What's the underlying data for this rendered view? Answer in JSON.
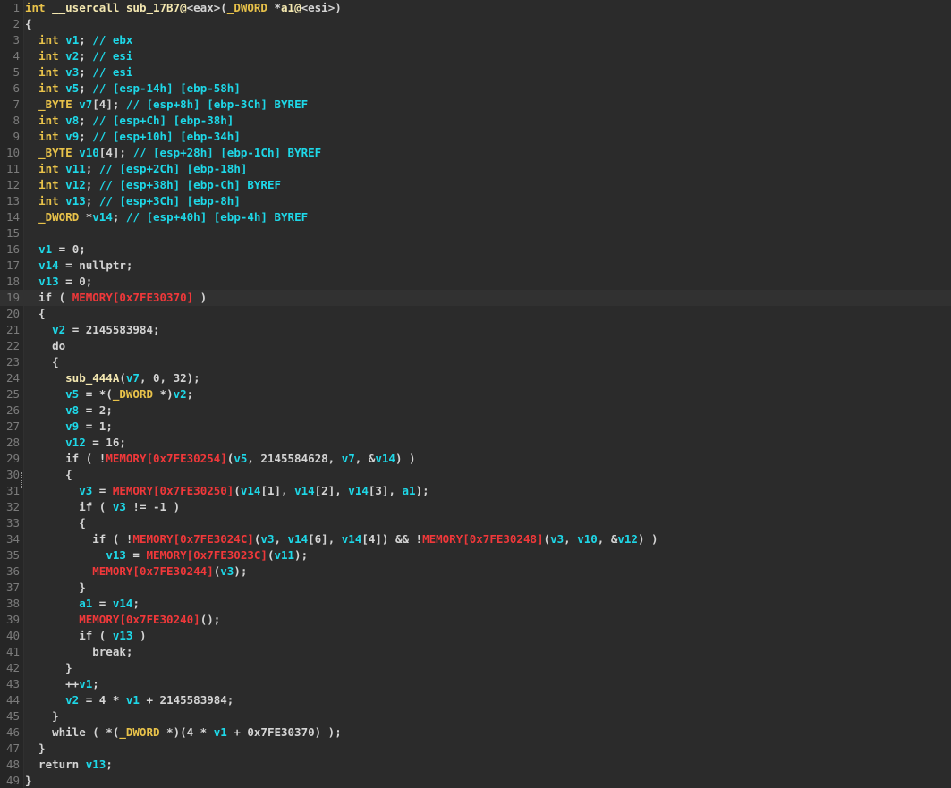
{
  "editor": {
    "highlighted_line": 19,
    "lines": [
      {
        "n": "1",
        "tokens": [
          [
            "kw",
            "int "
          ],
          [
            "fn",
            "__usercall sub_17B7@"
          ],
          [
            "pl",
            "<eax>"
          ],
          [
            "pl",
            "("
          ],
          [
            "tp",
            "_DWORD "
          ],
          [
            "pl",
            "*"
          ],
          [
            "fn",
            "a1@"
          ],
          [
            "pl",
            "<esi>"
          ],
          [
            "pl",
            ")"
          ]
        ]
      },
      {
        "n": "2",
        "tokens": [
          [
            "pl",
            "{"
          ]
        ]
      },
      {
        "n": "3",
        "tokens": [
          [
            "pl",
            "  "
          ],
          [
            "kw",
            "int "
          ],
          [
            "var",
            "v1"
          ],
          [
            "pl",
            "; "
          ],
          [
            "cm",
            "// ebx"
          ]
        ]
      },
      {
        "n": "4",
        "tokens": [
          [
            "pl",
            "  "
          ],
          [
            "kw",
            "int "
          ],
          [
            "var",
            "v2"
          ],
          [
            "pl",
            "; "
          ],
          [
            "cm",
            "// esi"
          ]
        ]
      },
      {
        "n": "5",
        "tokens": [
          [
            "pl",
            "  "
          ],
          [
            "kw",
            "int "
          ],
          [
            "var",
            "v3"
          ],
          [
            "pl",
            "; "
          ],
          [
            "cm",
            "// esi"
          ]
        ]
      },
      {
        "n": "6",
        "tokens": [
          [
            "pl",
            "  "
          ],
          [
            "kw",
            "int "
          ],
          [
            "var",
            "v5"
          ],
          [
            "pl",
            "; "
          ],
          [
            "cm",
            "// [esp-14h] [ebp-58h]"
          ]
        ]
      },
      {
        "n": "7",
        "tokens": [
          [
            "pl",
            "  "
          ],
          [
            "tp",
            "_BYTE "
          ],
          [
            "var",
            "v7"
          ],
          [
            "pl",
            "[4]; "
          ],
          [
            "cm",
            "// [esp+8h] [ebp-3Ch] BYREF"
          ]
        ]
      },
      {
        "n": "8",
        "tokens": [
          [
            "pl",
            "  "
          ],
          [
            "kw",
            "int "
          ],
          [
            "var",
            "v8"
          ],
          [
            "pl",
            "; "
          ],
          [
            "cm",
            "// [esp+Ch] [ebp-38h]"
          ]
        ]
      },
      {
        "n": "9",
        "tokens": [
          [
            "pl",
            "  "
          ],
          [
            "kw",
            "int "
          ],
          [
            "var",
            "v9"
          ],
          [
            "pl",
            "; "
          ],
          [
            "cm",
            "// [esp+10h] [ebp-34h]"
          ]
        ]
      },
      {
        "n": "10",
        "tokens": [
          [
            "pl",
            "  "
          ],
          [
            "tp",
            "_BYTE "
          ],
          [
            "var",
            "v10"
          ],
          [
            "pl",
            "[4]; "
          ],
          [
            "cm",
            "// [esp+28h] [ebp-1Ch] BYREF"
          ]
        ]
      },
      {
        "n": "11",
        "tokens": [
          [
            "pl",
            "  "
          ],
          [
            "kw",
            "int "
          ],
          [
            "var",
            "v11"
          ],
          [
            "pl",
            "; "
          ],
          [
            "cm",
            "// [esp+2Ch] [ebp-18h]"
          ]
        ]
      },
      {
        "n": "12",
        "tokens": [
          [
            "pl",
            "  "
          ],
          [
            "kw",
            "int "
          ],
          [
            "var",
            "v12"
          ],
          [
            "pl",
            "; "
          ],
          [
            "cm",
            "// [esp+38h] [ebp-Ch] BYREF"
          ]
        ]
      },
      {
        "n": "13",
        "tokens": [
          [
            "pl",
            "  "
          ],
          [
            "kw",
            "int "
          ],
          [
            "var",
            "v13"
          ],
          [
            "pl",
            "; "
          ],
          [
            "cm",
            "// [esp+3Ch] [ebp-8h]"
          ]
        ]
      },
      {
        "n": "14",
        "tokens": [
          [
            "pl",
            "  "
          ],
          [
            "tp",
            "_DWORD "
          ],
          [
            "pl",
            "*"
          ],
          [
            "var",
            "v14"
          ],
          [
            "pl",
            "; "
          ],
          [
            "cm",
            "// [esp+40h] [ebp-4h] BYREF"
          ]
        ]
      },
      {
        "n": "15",
        "tokens": []
      },
      {
        "n": "16",
        "tokens": [
          [
            "pl",
            "  "
          ],
          [
            "var",
            "v1"
          ],
          [
            "pl",
            " = 0;"
          ]
        ]
      },
      {
        "n": "17",
        "tokens": [
          [
            "pl",
            "  "
          ],
          [
            "var",
            "v14"
          ],
          [
            "pl",
            " = nullptr;"
          ]
        ]
      },
      {
        "n": "18",
        "tokens": [
          [
            "pl",
            "  "
          ],
          [
            "var",
            "v13"
          ],
          [
            "pl",
            " = 0;"
          ]
        ]
      },
      {
        "n": "19",
        "tokens": [
          [
            "pl",
            "  if ( "
          ],
          [
            "mem",
            "MEMORY[0x7FE30370]"
          ],
          [
            "pl",
            " )"
          ]
        ]
      },
      {
        "n": "20",
        "tokens": [
          [
            "pl",
            "  {"
          ]
        ]
      },
      {
        "n": "21",
        "tokens": [
          [
            "pl",
            "    "
          ],
          [
            "var",
            "v2"
          ],
          [
            "pl",
            " = 2145583984;"
          ]
        ]
      },
      {
        "n": "22",
        "tokens": [
          [
            "pl",
            "    do"
          ]
        ]
      },
      {
        "n": "23",
        "tokens": [
          [
            "pl",
            "    {"
          ]
        ]
      },
      {
        "n": "24",
        "tokens": [
          [
            "pl",
            "      "
          ],
          [
            "fn",
            "sub_444A"
          ],
          [
            "pl",
            "("
          ],
          [
            "var",
            "v7"
          ],
          [
            "pl",
            ", 0, 32);"
          ]
        ]
      },
      {
        "n": "25",
        "tokens": [
          [
            "pl",
            "      "
          ],
          [
            "var",
            "v5"
          ],
          [
            "pl",
            " = *("
          ],
          [
            "tp",
            "_DWORD "
          ],
          [
            "pl",
            "*)"
          ],
          [
            "var",
            "v2"
          ],
          [
            "pl",
            ";"
          ]
        ]
      },
      {
        "n": "26",
        "tokens": [
          [
            "pl",
            "      "
          ],
          [
            "var",
            "v8"
          ],
          [
            "pl",
            " = 2;"
          ]
        ]
      },
      {
        "n": "27",
        "tokens": [
          [
            "pl",
            "      "
          ],
          [
            "var",
            "v9"
          ],
          [
            "pl",
            " = 1;"
          ]
        ]
      },
      {
        "n": "28",
        "tokens": [
          [
            "pl",
            "      "
          ],
          [
            "var",
            "v12"
          ],
          [
            "pl",
            " = 16;"
          ]
        ]
      },
      {
        "n": "29",
        "tokens": [
          [
            "pl",
            "      if ( !"
          ],
          [
            "mem",
            "MEMORY[0x7FE30254]"
          ],
          [
            "pl",
            "("
          ],
          [
            "var",
            "v5"
          ],
          [
            "pl",
            ", 2145584628, "
          ],
          [
            "var",
            "v7"
          ],
          [
            "pl",
            ", &"
          ],
          [
            "var",
            "v14"
          ],
          [
            "pl",
            ") )"
          ]
        ]
      },
      {
        "n": "30",
        "tokens": [
          [
            "pl",
            "      {"
          ]
        ]
      },
      {
        "n": "31",
        "tokens": [
          [
            "pl",
            "        "
          ],
          [
            "var",
            "v3"
          ],
          [
            "pl",
            " = "
          ],
          [
            "mem",
            "MEMORY[0x7FE30250]"
          ],
          [
            "pl",
            "("
          ],
          [
            "var",
            "v14"
          ],
          [
            "pl",
            "[1], "
          ],
          [
            "var",
            "v14"
          ],
          [
            "pl",
            "[2], "
          ],
          [
            "var",
            "v14"
          ],
          [
            "pl",
            "[3], "
          ],
          [
            "var",
            "a1"
          ],
          [
            "pl",
            ");"
          ]
        ]
      },
      {
        "n": "32",
        "tokens": [
          [
            "pl",
            "        if ( "
          ],
          [
            "var",
            "v3"
          ],
          [
            "pl",
            " != -1 )"
          ]
        ]
      },
      {
        "n": "33",
        "tokens": [
          [
            "pl",
            "        {"
          ]
        ]
      },
      {
        "n": "34",
        "tokens": [
          [
            "pl",
            "          if ( !"
          ],
          [
            "mem",
            "MEMORY[0x7FE3024C]"
          ],
          [
            "pl",
            "("
          ],
          [
            "var",
            "v3"
          ],
          [
            "pl",
            ", "
          ],
          [
            "var",
            "v14"
          ],
          [
            "pl",
            "[6], "
          ],
          [
            "var",
            "v14"
          ],
          [
            "pl",
            "[4]) && !"
          ],
          [
            "mem",
            "MEMORY[0x7FE30248]"
          ],
          [
            "pl",
            "("
          ],
          [
            "var",
            "v3"
          ],
          [
            "pl",
            ", "
          ],
          [
            "var",
            "v10"
          ],
          [
            "pl",
            ", &"
          ],
          [
            "var",
            "v12"
          ],
          [
            "pl",
            ") )"
          ]
        ]
      },
      {
        "n": "35",
        "tokens": [
          [
            "pl",
            "            "
          ],
          [
            "var",
            "v13"
          ],
          [
            "pl",
            " = "
          ],
          [
            "mem",
            "MEMORY[0x7FE3023C]"
          ],
          [
            "pl",
            "("
          ],
          [
            "var",
            "v11"
          ],
          [
            "pl",
            ");"
          ]
        ]
      },
      {
        "n": "36",
        "tokens": [
          [
            "pl",
            "          "
          ],
          [
            "mem",
            "MEMORY[0x7FE30244]"
          ],
          [
            "pl",
            "("
          ],
          [
            "var",
            "v3"
          ],
          [
            "pl",
            ");"
          ]
        ]
      },
      {
        "n": "37",
        "tokens": [
          [
            "pl",
            "        }"
          ]
        ]
      },
      {
        "n": "38",
        "tokens": [
          [
            "pl",
            "        "
          ],
          [
            "var",
            "a1"
          ],
          [
            "pl",
            " = "
          ],
          [
            "var",
            "v14"
          ],
          [
            "pl",
            ";"
          ]
        ]
      },
      {
        "n": "39",
        "tokens": [
          [
            "pl",
            "        "
          ],
          [
            "mem",
            "MEMORY[0x7FE30240]"
          ],
          [
            "pl",
            "();"
          ]
        ]
      },
      {
        "n": "40",
        "tokens": [
          [
            "pl",
            "        if ( "
          ],
          [
            "var",
            "v13"
          ],
          [
            "pl",
            " )"
          ]
        ]
      },
      {
        "n": "41",
        "tokens": [
          [
            "pl",
            "          break;"
          ]
        ]
      },
      {
        "n": "42",
        "tokens": [
          [
            "pl",
            "      }"
          ]
        ]
      },
      {
        "n": "43",
        "tokens": [
          [
            "pl",
            "      ++"
          ],
          [
            "var",
            "v1"
          ],
          [
            "pl",
            ";"
          ]
        ]
      },
      {
        "n": "44",
        "tokens": [
          [
            "pl",
            "      "
          ],
          [
            "var",
            "v2"
          ],
          [
            "pl",
            " = 4 * "
          ],
          [
            "var",
            "v1"
          ],
          [
            "pl",
            " + 2145583984;"
          ]
        ]
      },
      {
        "n": "45",
        "tokens": [
          [
            "pl",
            "    }"
          ]
        ]
      },
      {
        "n": "46",
        "tokens": [
          [
            "pl",
            "    while ( *("
          ],
          [
            "tp",
            "_DWORD "
          ],
          [
            "pl",
            "*)(4 * "
          ],
          [
            "var",
            "v1"
          ],
          [
            "pl",
            " + 0x7FE30370) );"
          ]
        ]
      },
      {
        "n": "47",
        "tokens": [
          [
            "pl",
            "  }"
          ]
        ]
      },
      {
        "n": "48",
        "tokens": [
          [
            "pl",
            "  return "
          ],
          [
            "var",
            "v13"
          ],
          [
            "pl",
            ";"
          ]
        ]
      },
      {
        "n": "49",
        "tokens": [
          [
            "pl",
            "}"
          ]
        ]
      }
    ]
  }
}
